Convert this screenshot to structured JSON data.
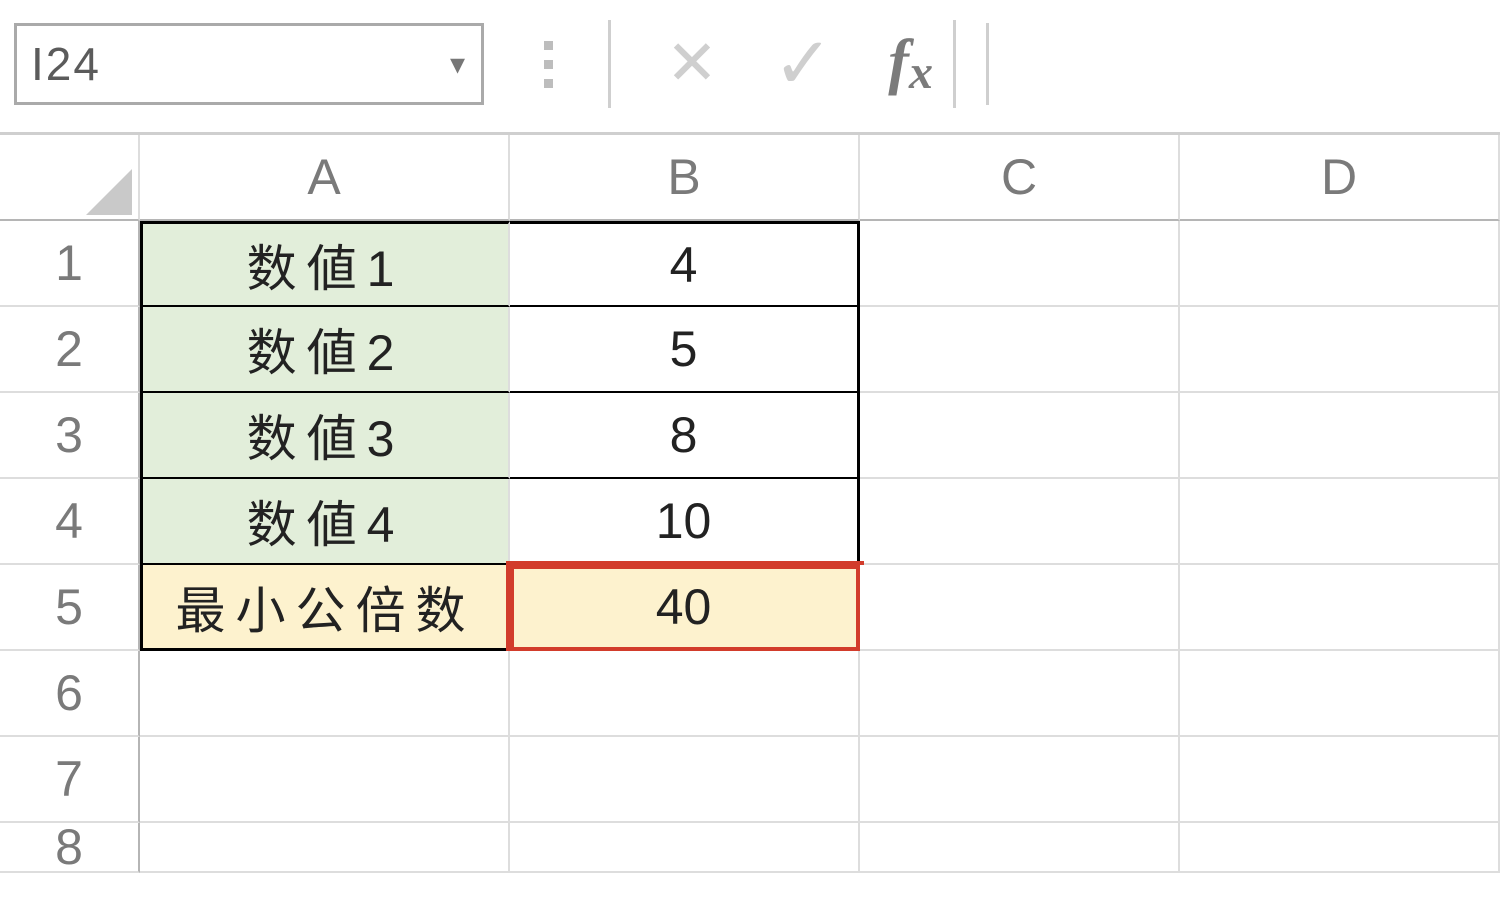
{
  "formula_bar": {
    "name_box": "I24",
    "formula": ""
  },
  "columns": [
    "A",
    "B",
    "C",
    "D"
  ],
  "row_numbers": [
    "1",
    "2",
    "3",
    "4",
    "5",
    "6",
    "7",
    "8"
  ],
  "sheet": {
    "rows": [
      {
        "label": "数値1",
        "value": "4"
      },
      {
        "label": "数値2",
        "value": "5"
      },
      {
        "label": "数値3",
        "value": "8"
      },
      {
        "label": "数値4",
        "value": "10"
      },
      {
        "label": "最小公倍数",
        "value": "40"
      }
    ]
  },
  "chart_data": {
    "type": "table",
    "title": "",
    "columns": [
      "A",
      "B"
    ],
    "rows": [
      [
        "数値1",
        4
      ],
      [
        "数値2",
        5
      ],
      [
        "数値3",
        8
      ],
      [
        "数値4",
        10
      ],
      [
        "最小公倍数",
        40
      ]
    ],
    "highlighted_cell": "B5",
    "current_cell": "I24"
  }
}
